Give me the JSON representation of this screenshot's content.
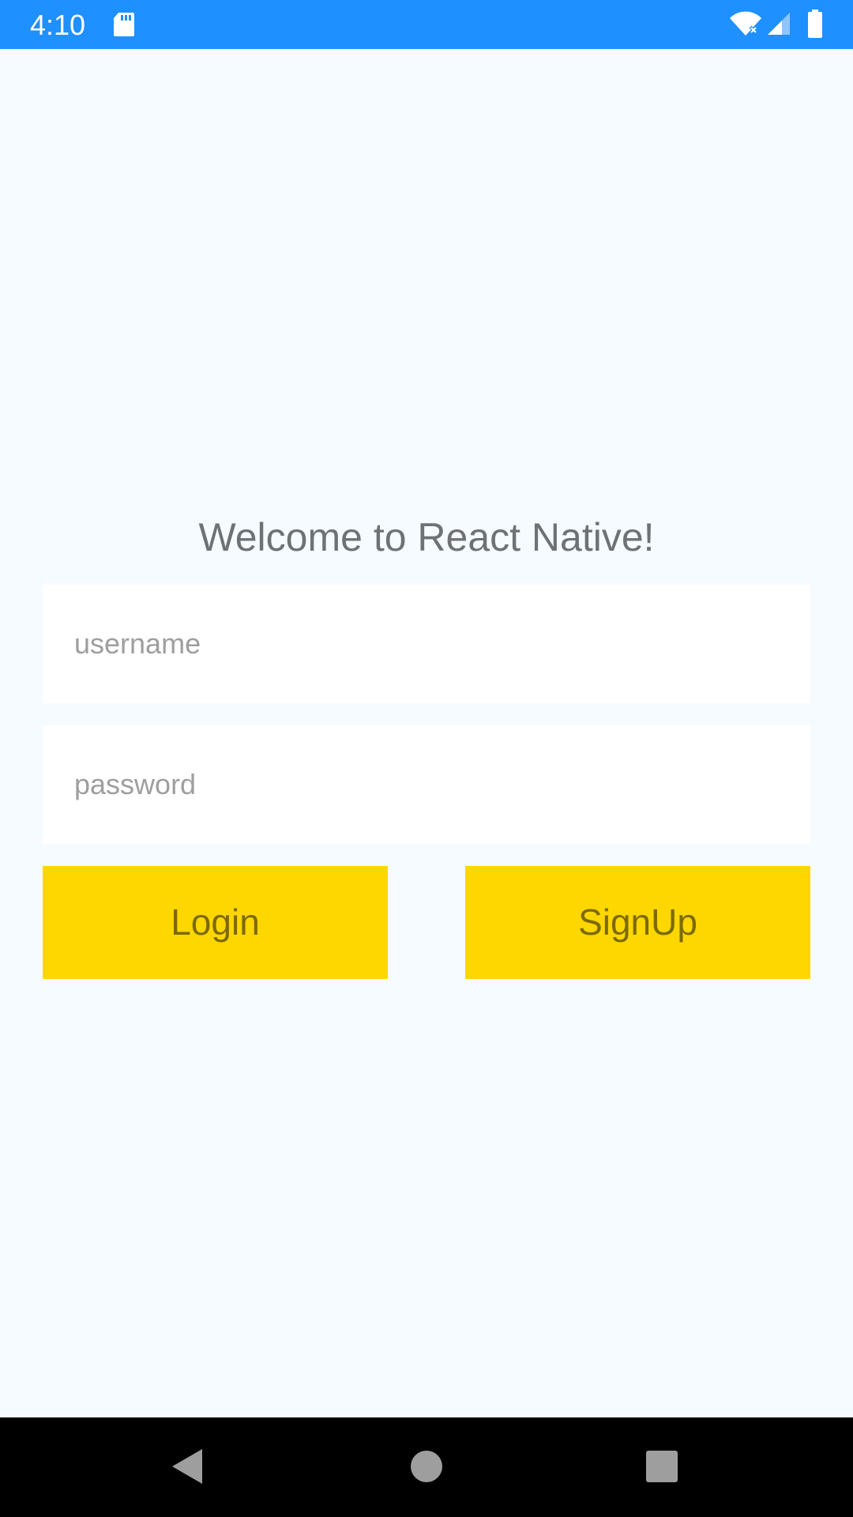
{
  "status_bar": {
    "time": "4:10",
    "background": "#1E90FF",
    "icons": [
      "sd-card-icon",
      "wifi-icon",
      "signal-icon",
      "battery-icon"
    ]
  },
  "screen": {
    "background": "#F5FBFF",
    "welcome_text": "Welcome to React Native!"
  },
  "form": {
    "username": {
      "value": "",
      "placeholder": "username"
    },
    "password": {
      "value": "",
      "placeholder": "password"
    }
  },
  "buttons": {
    "login_label": "Login",
    "signup_label": "SignUp",
    "color": "#FFD700"
  },
  "nav_bar": {
    "icons": [
      "back-icon",
      "home-icon",
      "recents-icon"
    ]
  }
}
